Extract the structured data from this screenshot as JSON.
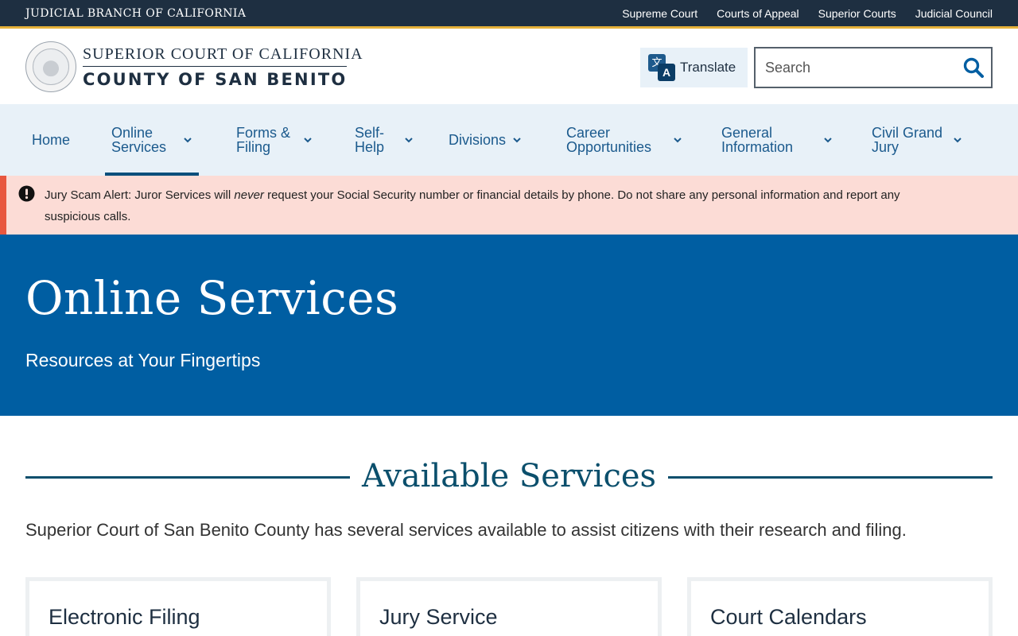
{
  "utility": {
    "branch": "JUDICIAL BRANCH OF CALIFORNIA",
    "links": [
      "Supreme Court",
      "Courts of Appeal",
      "Superior Courts",
      "Judicial Council"
    ]
  },
  "header": {
    "line1": "SUPERIOR COURT OF CALIFORNIA",
    "line2": "COUNTY OF SAN BENITO",
    "translate_label": "Translate",
    "translate_glyph_1": "文",
    "translate_glyph_2": "A",
    "search_placeholder": "Search"
  },
  "nav": {
    "items": [
      {
        "label": "Home",
        "has_menu": false
      },
      {
        "label": "Online Services",
        "has_menu": true,
        "active": true
      },
      {
        "label": "Forms & Filing",
        "has_menu": true
      },
      {
        "label": "Self-Help",
        "has_menu": true
      },
      {
        "label": "Divisions",
        "has_menu": true
      },
      {
        "label": "Career Opportunities",
        "has_menu": true
      },
      {
        "label": "General Information",
        "has_menu": true
      },
      {
        "label": "Civil Grand Jury",
        "has_menu": true
      }
    ]
  },
  "alert": {
    "icon": "exclamation-circle-icon",
    "prefix": "Jury Scam Alert: Juror Services will ",
    "emphasis": "never",
    "suffix": " request your Social Security number or financial details by phone. Do not share any personal information and report any suspicious calls."
  },
  "hero": {
    "title": "Online Services",
    "subtitle": "Resources at Your Fingertips"
  },
  "main": {
    "heading": "Available Services",
    "intro": "Superior Court of San Benito County has several services available to assist citizens with their research and filing.",
    "cards": [
      {
        "title": "Electronic Filing"
      },
      {
        "title": "Jury Service"
      },
      {
        "title": "Court Calendars"
      }
    ]
  },
  "colors": {
    "utility_bg": "#1e2f41",
    "accent_gold": "#e5b13a",
    "nav_bg": "#e8f1f8",
    "nav_text": "#1b5a8d",
    "alert_bg": "#fcdcd6",
    "alert_border": "#e8573f",
    "hero_bg": "#005ea2",
    "heading": "#0b4f6c"
  }
}
